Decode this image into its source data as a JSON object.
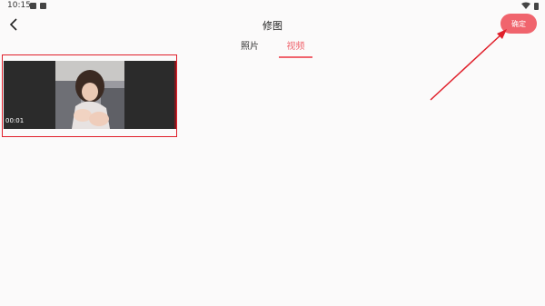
{
  "status_bar": {
    "time": "10:15",
    "icons": [
      "image-icon",
      "app-icon",
      "wifi-icon",
      "battery-icon"
    ]
  },
  "header": {
    "title": "修图",
    "back_icon": "chevron-left-icon",
    "confirm_label": "确定"
  },
  "tabs": [
    {
      "label": "照片",
      "active": false
    },
    {
      "label": "视频",
      "active": true
    }
  ],
  "videos": [
    {
      "duration": "00:01"
    }
  ],
  "colors": {
    "accent": "#f0646d",
    "annotation": "#e01f2a",
    "background": "#fbfafa"
  }
}
